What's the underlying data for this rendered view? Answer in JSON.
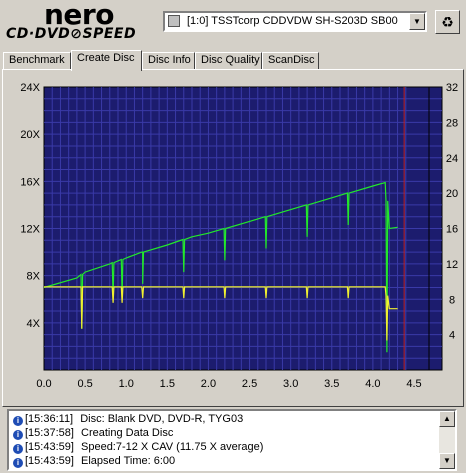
{
  "header": {
    "logo_main": "nero",
    "logo_sub": "CD·DVD⊘SPEED",
    "drive_select_value": "[1:0]  TSSTcorp CDDVDW SH-S203D SB00"
  },
  "tabs": [
    {
      "label": "Benchmark",
      "active": false
    },
    {
      "label": "Create Disc",
      "active": true
    },
    {
      "label": "Disc Info",
      "active": false
    },
    {
      "label": "Disc Quality",
      "active": false
    },
    {
      "label": "ScanDisc",
      "active": false
    }
  ],
  "chart_data": {
    "type": "line",
    "x_ticks": [
      "0.0",
      "0.5",
      "1.0",
      "1.5",
      "2.0",
      "2.5",
      "3.0",
      "3.5",
      "4.0",
      "4.5"
    ],
    "y_left_ticks": [
      "4X",
      "8X",
      "12X",
      "16X",
      "20X",
      "24X"
    ],
    "y_right_ticks": [
      "4",
      "8",
      "12",
      "16",
      "20",
      "24",
      "28",
      "32"
    ],
    "xlim": [
      0,
      4.5
    ],
    "ylim_left": [
      0,
      24
    ],
    "ylim_right": [
      0,
      32
    ],
    "grid": true,
    "background": "#1c1c6e",
    "grid_color": "#3a3aa8",
    "end_marker_x": 4.38,
    "series": [
      {
        "color": "#22e82a",
        "values": [
          [
            0.0,
            7.0
          ],
          [
            0.4,
            7.8
          ],
          [
            0.5,
            8.3
          ],
          [
            0.8,
            9.0
          ],
          [
            1.0,
            9.5
          ],
          [
            1.2,
            10.0
          ],
          [
            1.5,
            10.6
          ],
          [
            1.8,
            11.3
          ],
          [
            2.0,
            11.6
          ],
          [
            2.5,
            12.6
          ],
          [
            3.0,
            13.6
          ],
          [
            3.5,
            14.6
          ],
          [
            4.0,
            15.6
          ],
          [
            4.15,
            15.9
          ],
          [
            4.2,
            12.0
          ],
          [
            4.3,
            12.1
          ]
        ]
      },
      {
        "color": "#f0f030",
        "values": [
          [
            0.0,
            7.05
          ],
          [
            0.5,
            7.05
          ],
          [
            1.0,
            7.05
          ],
          [
            1.5,
            7.05
          ],
          [
            2.0,
            7.05
          ],
          [
            2.5,
            7.05
          ],
          [
            3.0,
            7.05
          ],
          [
            3.5,
            7.05
          ],
          [
            4.0,
            7.05
          ],
          [
            4.15,
            7.05
          ],
          [
            4.2,
            5.2
          ],
          [
            4.3,
            5.2
          ]
        ]
      }
    ]
  },
  "log": [
    {
      "time": "[15:36:11]",
      "message": "Disc: Blank DVD, DVD-R, TYG03"
    },
    {
      "time": "[15:37:58]",
      "message": "Creating Data Disc"
    },
    {
      "time": "[15:43:59]",
      "message": "Speed:7-12 X CAV (11.75 X average)"
    },
    {
      "time": "[15:43:59]",
      "message": "Elapsed Time:  6:00"
    }
  ]
}
